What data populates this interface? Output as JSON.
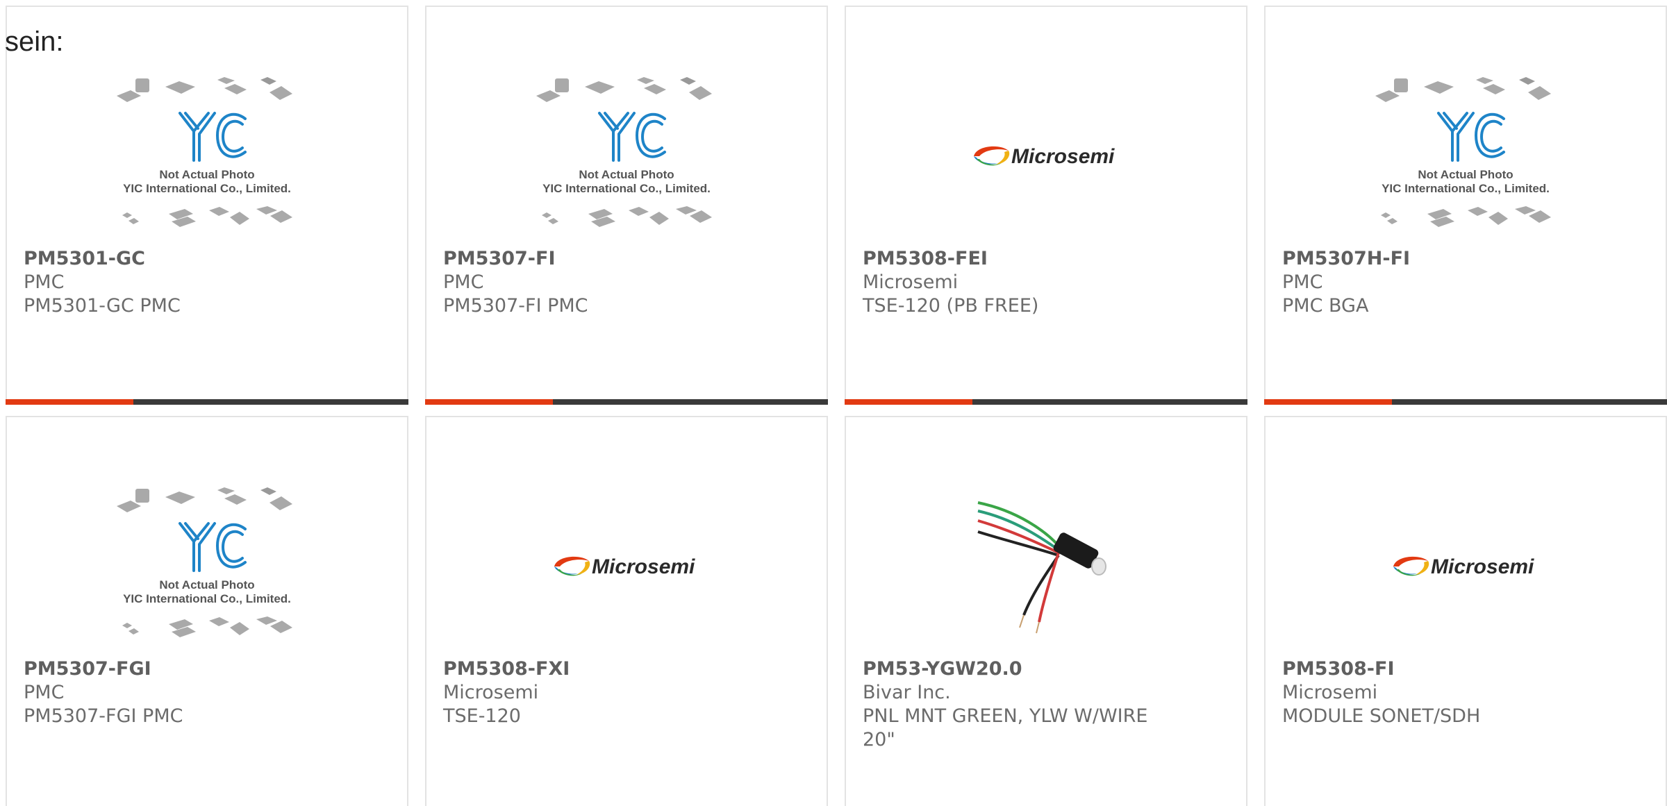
{
  "top_text": "sein:",
  "colors": {
    "accent": "#e23a12",
    "bar": "#3a3a3a",
    "border": "#e3e3e3",
    "text": "#6b6b6b"
  },
  "products": [
    {
      "part_number": "PM5301-GC",
      "manufacturer": "PMC",
      "description": "PM5301-GC PMC",
      "image": "yic-placeholder"
    },
    {
      "part_number": "PM5307-FI",
      "manufacturer": "PMC",
      "description": "PM5307-FI PMC",
      "image": "yic-placeholder"
    },
    {
      "part_number": "PM5308-FEI",
      "manufacturer": "Microsemi",
      "description": "TSE-120 (PB FREE)",
      "image": "microsemi-logo"
    },
    {
      "part_number": "PM5307H-FI",
      "manufacturer": "PMC",
      "description": "PMC BGA",
      "image": "yic-placeholder"
    },
    {
      "part_number": "PM5307-FGI",
      "manufacturer": "PMC",
      "description": "PM5307-FGI PMC",
      "image": "yic-placeholder"
    },
    {
      "part_number": "PM5308-FXI",
      "manufacturer": "Microsemi",
      "description": "TSE-120",
      "image": "microsemi-logo"
    },
    {
      "part_number": "PM53-YGW20.0",
      "manufacturer": "Bivar Inc.",
      "description": "PNL MNT GREEN, YLW W/WIRE 20\"",
      "image": "led-wire-photo"
    },
    {
      "part_number": "PM5308-FI",
      "manufacturer": "Microsemi",
      "description": "MODULE SONET/SDH",
      "image": "microsemi-logo"
    }
  ],
  "placeholder": {
    "brand": "YIC",
    "line1": "Not Actual Photo",
    "line2": "YIC International Co., Limited."
  },
  "logo_text": "Microsemi"
}
